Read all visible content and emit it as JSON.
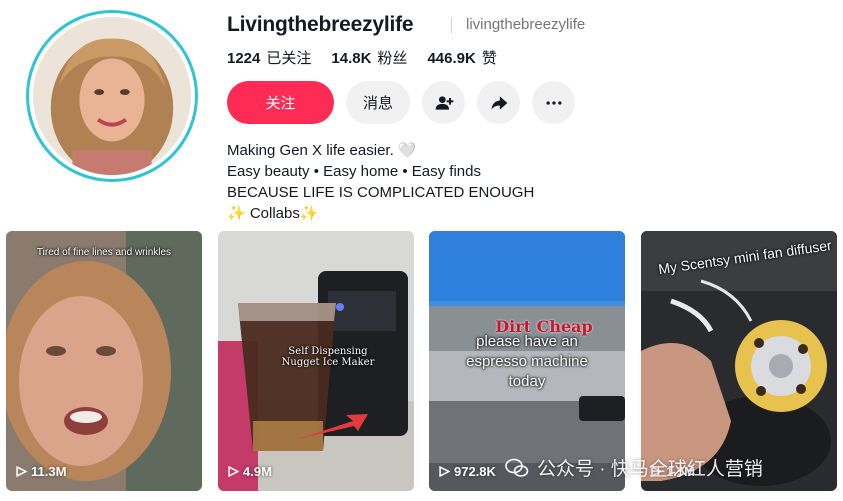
{
  "profile": {
    "username": "Livingthebreezylife",
    "handle": "livingthebreezylife",
    "stats": [
      {
        "value": "1224",
        "label": "已关注"
      },
      {
        "value": "14.8K",
        "label": "粉丝"
      },
      {
        "value": "446.9K",
        "label": "赞"
      }
    ],
    "actions": {
      "follow_label": "关注",
      "message_label": "消息",
      "add_friend_icon": "add-friend-icon",
      "share_icon": "share-icon",
      "more_icon": "more-icon"
    },
    "bio": [
      "Making Gen X life easier. 🤍",
      "Easy beauty • Easy home • Easy finds",
      "BECAUSE LIFE IS COMPLICATED ENOUGH",
      "✨ Collabs✨"
    ]
  },
  "videos": [
    {
      "views": "11.3M",
      "caption": "Tired of fine lines and wrinkles"
    },
    {
      "views": "4.9M",
      "caption": "Self Dispensing Nugget Ice Maker"
    },
    {
      "views": "972.8K",
      "caption": "please have an espresso machine today",
      "sign": "Dirt Cheap"
    },
    {
      "views": "1.5M",
      "caption": "My Scentsy mini fan diffuser"
    }
  ],
  "watermark": {
    "text": "公众号 · 快马全球红人营销"
  },
  "colors": {
    "accent": "#fe2c55",
    "avatar_ring": "#2ec4d6",
    "button_bg": "#f1f1f2",
    "muted_text": "#75767c"
  }
}
